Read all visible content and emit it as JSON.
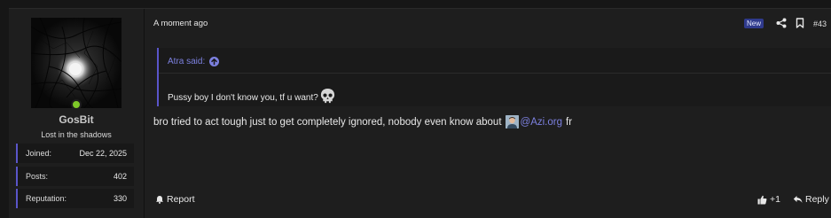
{
  "user": {
    "name": "GosBit",
    "title": "Lost in the shadows",
    "stats": [
      {
        "label": "Joined:",
        "value": "Dec 22, 2025"
      },
      {
        "label": "Posts:",
        "value": "402"
      },
      {
        "label": "Reputation:",
        "value": "330"
      }
    ],
    "online_color": "#7ec828"
  },
  "post": {
    "time": "A moment ago",
    "badge": "New",
    "number": "#43",
    "quote": {
      "author": "Atra said:",
      "text": "Pussy boy I don't know you, tf u want?",
      "emoji": "skull-icon"
    },
    "message": {
      "text": "bro tried to act tough just to get completely ignored, nobody even know about",
      "mention": "@Azi.org",
      "suffix": "fr"
    },
    "actions": {
      "report": "Report",
      "likes": "+1",
      "reply": "Reply"
    }
  },
  "colors": {
    "accent": "#5a55c9",
    "link": "#7c80df",
    "badge_bg": "#2f3a8c"
  }
}
